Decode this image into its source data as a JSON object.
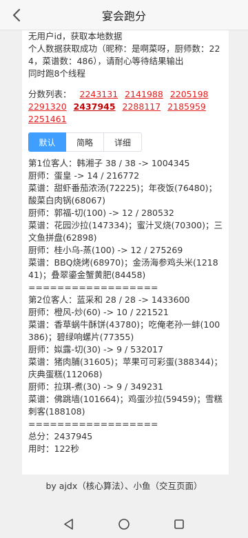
{
  "header": {
    "title": "宴会跑分"
  },
  "log": {
    "lines": [
      "无用户id，获取本地数据",
      "个人数据获取成功（昵称：是啊菜呀，厨师数：224，菜谱数：486），请耐心等待结果输出",
      "同时跑8个线程"
    ]
  },
  "scores": {
    "label": "分数列表：",
    "items": [
      "2243131",
      "2141988",
      "2205198",
      "2291320",
      "2437945",
      "2288117",
      "2185959",
      "2251461"
    ],
    "active_index": 4
  },
  "view_tabs": [
    {
      "label": "默认",
      "active": true
    },
    {
      "label": "简略",
      "active": false
    },
    {
      "label": "详细",
      "active": false
    }
  ],
  "result": {
    "lines": [
      "第1位客人：韩湘子 38 / 38 -> 1004345",
      "厨师：蛋皇 -> 14 / 216772",
      "菜谱：甜虾番茄浓汤(72225)；年夜饭(76480)；酸菜白肉锅(68067)",
      "厨师：郭福-切(100) -> 12 / 280532",
      "菜谱：花园沙拉(147334)；蜜汁叉烧(70300)；三文鱼拼盘(62898)",
      "厨师：桂小乌-蒸(100) -> 12 / 275269",
      "菜谱：BBQ烧烤(68970)；金汤海参鸡头米(121841)；叠翠鎏金蟹黄肥(84458)",
      "==================",
      "第2位客人：蓝采和 28 / 28 -> 1433600",
      "厨师：橙风-炒(60) -> 10 / 221521",
      "菜谱：香草蜗牛酥饼(43780)；吃俺老孙一蚌(100386)；碧绿响螺片(77355)",
      "厨师：姒露-切(30) -> 9 / 532017",
      "菜谱：猪肉脯(31605)；苹果可可彩蛋(388344)；庆典蛋糕(112068)",
      "厨师：拉琪-煮(30) -> 9 / 349231",
      "菜谱：佛跳墙(101664)；鸡蛋沙拉(59459)；雪糕刺客(188108)",
      "==================",
      "总分：2437945",
      "用时：122秒"
    ]
  },
  "footer": {
    "credits": "by ajdx（核心算法）、小鱼（交互页面）"
  },
  "colors": {
    "accent": "#409eff",
    "score_link": "#e02020"
  },
  "icons": {
    "back": "chevron-left-icon",
    "nav_back": "triangle-back-icon",
    "nav_home": "circle-home-icon",
    "nav_recent": "square-recent-icon"
  }
}
